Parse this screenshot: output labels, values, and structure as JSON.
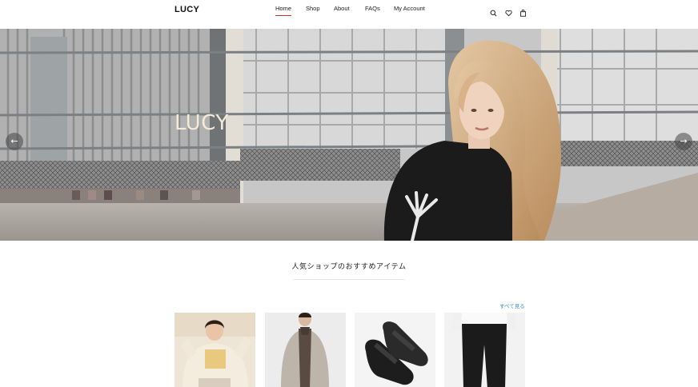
{
  "brand": "LUCY",
  "nav": {
    "items": [
      {
        "label": "Home",
        "active": true
      },
      {
        "label": "Shop",
        "active": false
      },
      {
        "label": "About",
        "active": false
      },
      {
        "label": "FAQs",
        "active": false
      },
      {
        "label": "My Account",
        "active": false
      }
    ]
  },
  "header_icons": [
    "search-icon",
    "heart-icon",
    "bag-icon"
  ],
  "hero": {
    "title": "LUCY",
    "prev_arrow": "←",
    "next_arrow": "→"
  },
  "section": {
    "title": "人気ショップのおすすめアイテム",
    "see_all": "すべて見る"
  },
  "products": [
    {
      "name": "beige puffer jacket outfit"
    },
    {
      "name": "grey long coat"
    },
    {
      "name": "black slide sandals"
    },
    {
      "name": "black wide trousers"
    }
  ],
  "colors": {
    "accent": "#c0392b",
    "link": "#3a8fc9",
    "hero_title": "#f5ead7"
  }
}
